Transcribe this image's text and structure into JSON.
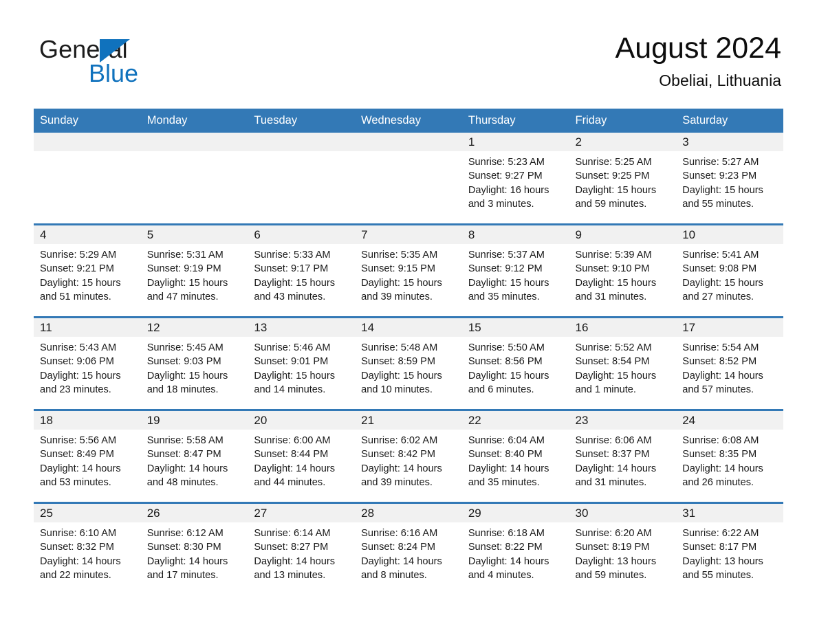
{
  "brand": {
    "line1": "General",
    "line2": "Blue",
    "triangle_color": "#1072bd"
  },
  "header": {
    "month_title": "August 2024",
    "location": "Obeliai, Lithuania"
  },
  "theme": {
    "header_blue": "#3379b6",
    "daynum_band": "#f1f1f1",
    "text": "#1a1a1a",
    "page_bg": "#ffffff"
  },
  "calendar": {
    "weekday_headers": [
      "Sunday",
      "Monday",
      "Tuesday",
      "Wednesday",
      "Thursday",
      "Friday",
      "Saturday"
    ],
    "weeks": [
      [
        {
          "day": "",
          "empty": true,
          "lines": []
        },
        {
          "day": "",
          "empty": true,
          "lines": []
        },
        {
          "day": "",
          "empty": true,
          "lines": []
        },
        {
          "day": "",
          "empty": true,
          "lines": []
        },
        {
          "day": "1",
          "empty": false,
          "lines": [
            "Sunrise: 5:23 AM",
            "Sunset: 9:27 PM",
            "Daylight: 16 hours and 3 minutes."
          ]
        },
        {
          "day": "2",
          "empty": false,
          "lines": [
            "Sunrise: 5:25 AM",
            "Sunset: 9:25 PM",
            "Daylight: 15 hours and 59 minutes."
          ]
        },
        {
          "day": "3",
          "empty": false,
          "lines": [
            "Sunrise: 5:27 AM",
            "Sunset: 9:23 PM",
            "Daylight: 15 hours and 55 minutes."
          ]
        }
      ],
      [
        {
          "day": "4",
          "empty": false,
          "lines": [
            "Sunrise: 5:29 AM",
            "Sunset: 9:21 PM",
            "Daylight: 15 hours and 51 minutes."
          ]
        },
        {
          "day": "5",
          "empty": false,
          "lines": [
            "Sunrise: 5:31 AM",
            "Sunset: 9:19 PM",
            "Daylight: 15 hours and 47 minutes."
          ]
        },
        {
          "day": "6",
          "empty": false,
          "lines": [
            "Sunrise: 5:33 AM",
            "Sunset: 9:17 PM",
            "Daylight: 15 hours and 43 minutes."
          ]
        },
        {
          "day": "7",
          "empty": false,
          "lines": [
            "Sunrise: 5:35 AM",
            "Sunset: 9:15 PM",
            "Daylight: 15 hours and 39 minutes."
          ]
        },
        {
          "day": "8",
          "empty": false,
          "lines": [
            "Sunrise: 5:37 AM",
            "Sunset: 9:12 PM",
            "Daylight: 15 hours and 35 minutes."
          ]
        },
        {
          "day": "9",
          "empty": false,
          "lines": [
            "Sunrise: 5:39 AM",
            "Sunset: 9:10 PM",
            "Daylight: 15 hours and 31 minutes."
          ]
        },
        {
          "day": "10",
          "empty": false,
          "lines": [
            "Sunrise: 5:41 AM",
            "Sunset: 9:08 PM",
            "Daylight: 15 hours and 27 minutes."
          ]
        }
      ],
      [
        {
          "day": "11",
          "empty": false,
          "lines": [
            "Sunrise: 5:43 AM",
            "Sunset: 9:06 PM",
            "Daylight: 15 hours and 23 minutes."
          ]
        },
        {
          "day": "12",
          "empty": false,
          "lines": [
            "Sunrise: 5:45 AM",
            "Sunset: 9:03 PM",
            "Daylight: 15 hours and 18 minutes."
          ]
        },
        {
          "day": "13",
          "empty": false,
          "lines": [
            "Sunrise: 5:46 AM",
            "Sunset: 9:01 PM",
            "Daylight: 15 hours and 14 minutes."
          ]
        },
        {
          "day": "14",
          "empty": false,
          "lines": [
            "Sunrise: 5:48 AM",
            "Sunset: 8:59 PM",
            "Daylight: 15 hours and 10 minutes."
          ]
        },
        {
          "day": "15",
          "empty": false,
          "lines": [
            "Sunrise: 5:50 AM",
            "Sunset: 8:56 PM",
            "Daylight: 15 hours and 6 minutes."
          ]
        },
        {
          "day": "16",
          "empty": false,
          "lines": [
            "Sunrise: 5:52 AM",
            "Sunset: 8:54 PM",
            "Daylight: 15 hours and 1 minute."
          ]
        },
        {
          "day": "17",
          "empty": false,
          "lines": [
            "Sunrise: 5:54 AM",
            "Sunset: 8:52 PM",
            "Daylight: 14 hours and 57 minutes."
          ]
        }
      ],
      [
        {
          "day": "18",
          "empty": false,
          "lines": [
            "Sunrise: 5:56 AM",
            "Sunset: 8:49 PM",
            "Daylight: 14 hours and 53 minutes."
          ]
        },
        {
          "day": "19",
          "empty": false,
          "lines": [
            "Sunrise: 5:58 AM",
            "Sunset: 8:47 PM",
            "Daylight: 14 hours and 48 minutes."
          ]
        },
        {
          "day": "20",
          "empty": false,
          "lines": [
            "Sunrise: 6:00 AM",
            "Sunset: 8:44 PM",
            "Daylight: 14 hours and 44 minutes."
          ]
        },
        {
          "day": "21",
          "empty": false,
          "lines": [
            "Sunrise: 6:02 AM",
            "Sunset: 8:42 PM",
            "Daylight: 14 hours and 39 minutes."
          ]
        },
        {
          "day": "22",
          "empty": false,
          "lines": [
            "Sunrise: 6:04 AM",
            "Sunset: 8:40 PM",
            "Daylight: 14 hours and 35 minutes."
          ]
        },
        {
          "day": "23",
          "empty": false,
          "lines": [
            "Sunrise: 6:06 AM",
            "Sunset: 8:37 PM",
            "Daylight: 14 hours and 31 minutes."
          ]
        },
        {
          "day": "24",
          "empty": false,
          "lines": [
            "Sunrise: 6:08 AM",
            "Sunset: 8:35 PM",
            "Daylight: 14 hours and 26 minutes."
          ]
        }
      ],
      [
        {
          "day": "25",
          "empty": false,
          "lines": [
            "Sunrise: 6:10 AM",
            "Sunset: 8:32 PM",
            "Daylight: 14 hours and 22 minutes."
          ]
        },
        {
          "day": "26",
          "empty": false,
          "lines": [
            "Sunrise: 6:12 AM",
            "Sunset: 8:30 PM",
            "Daylight: 14 hours and 17 minutes."
          ]
        },
        {
          "day": "27",
          "empty": false,
          "lines": [
            "Sunrise: 6:14 AM",
            "Sunset: 8:27 PM",
            "Daylight: 14 hours and 13 minutes."
          ]
        },
        {
          "day": "28",
          "empty": false,
          "lines": [
            "Sunrise: 6:16 AM",
            "Sunset: 8:24 PM",
            "Daylight: 14 hours and 8 minutes."
          ]
        },
        {
          "day": "29",
          "empty": false,
          "lines": [
            "Sunrise: 6:18 AM",
            "Sunset: 8:22 PM",
            "Daylight: 14 hours and 4 minutes."
          ]
        },
        {
          "day": "30",
          "empty": false,
          "lines": [
            "Sunrise: 6:20 AM",
            "Sunset: 8:19 PM",
            "Daylight: 13 hours and 59 minutes."
          ]
        },
        {
          "day": "31",
          "empty": false,
          "lines": [
            "Sunrise: 6:22 AM",
            "Sunset: 8:17 PM",
            "Daylight: 13 hours and 55 minutes."
          ]
        }
      ]
    ]
  }
}
